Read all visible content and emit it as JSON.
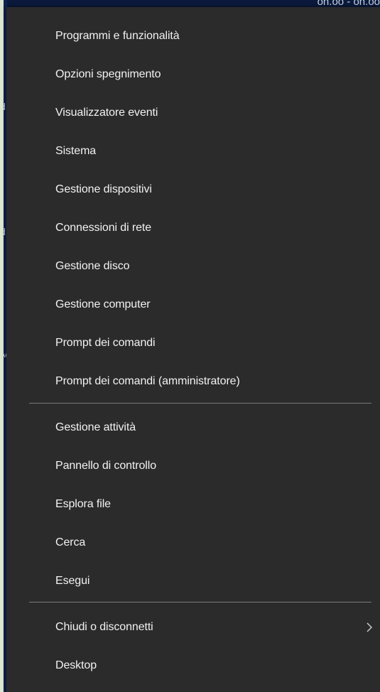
{
  "backdrop": {
    "top_text": "on.oo - on.oo",
    "left_glyphs": [
      "d",
      "d",
      "l",
      "Ac"
    ]
  },
  "menu": {
    "group1": [
      {
        "name": "programs-and-features",
        "label": "Programmi e funzionalità"
      },
      {
        "name": "power-options",
        "label": "Opzioni spegnimento"
      },
      {
        "name": "event-viewer",
        "label": "Visualizzatore eventi"
      },
      {
        "name": "system",
        "label": "Sistema"
      },
      {
        "name": "device-manager",
        "label": "Gestione dispositivi"
      },
      {
        "name": "network-connections",
        "label": "Connessioni di rete"
      },
      {
        "name": "disk-management",
        "label": "Gestione disco"
      },
      {
        "name": "computer-management",
        "label": "Gestione computer"
      },
      {
        "name": "command-prompt",
        "label": "Prompt dei comandi"
      },
      {
        "name": "command-prompt-admin",
        "label": "Prompt dei comandi (amministratore)"
      }
    ],
    "group2": [
      {
        "name": "task-manager",
        "label": "Gestione attività"
      },
      {
        "name": "control-panel",
        "label": "Pannello di controllo"
      },
      {
        "name": "file-explorer",
        "label": "Esplora file"
      },
      {
        "name": "search",
        "label": "Cerca"
      },
      {
        "name": "run",
        "label": "Esegui"
      }
    ],
    "group3": [
      {
        "name": "shutdown-or-sign-out",
        "label": "Chiudi o disconnetti",
        "has_submenu": true
      },
      {
        "name": "desktop",
        "label": "Desktop"
      }
    ]
  },
  "colors": {
    "menu_bg": "#2b2b2b",
    "text": "#f2f2f2",
    "separator": "#7a7a7a"
  }
}
